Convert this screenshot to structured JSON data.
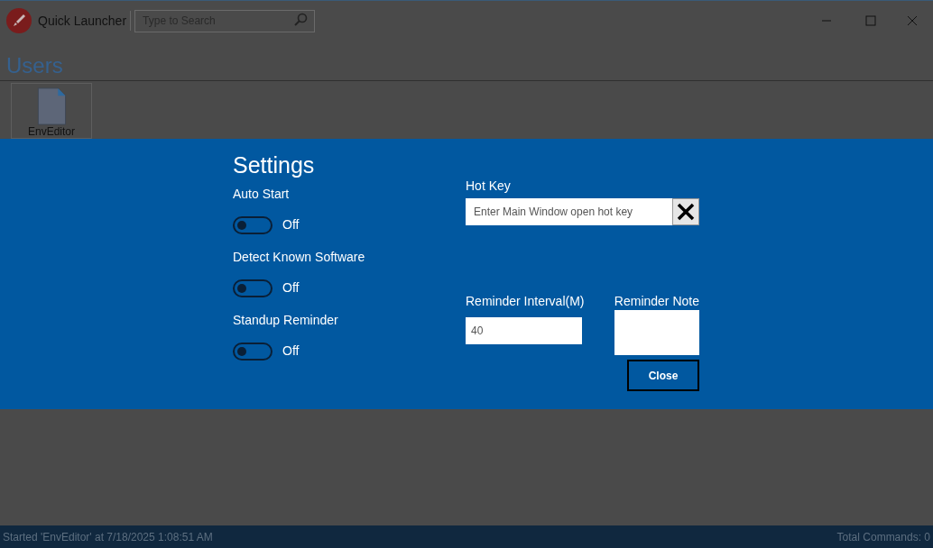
{
  "window": {
    "title": "Quick Launcher"
  },
  "search": {
    "placeholder": "Type to Search"
  },
  "group": {
    "title": "Users"
  },
  "tiles": [
    {
      "label": "EnvEditor"
    }
  ],
  "settings": {
    "title": "Settings",
    "toggles": [
      {
        "label": "Auto Start",
        "on": false,
        "state_text": "Off"
      },
      {
        "label": "Detect Known Software",
        "on": false,
        "state_text": "Off"
      },
      {
        "label": "Standup Reminder",
        "on": false,
        "state_text": "Off"
      }
    ],
    "hot_key": {
      "label": "Hot Key",
      "placeholder": "Enter Main Window open hot key"
    },
    "reminder_interval": {
      "label": "Reminder Interval(M)",
      "value": "40"
    },
    "reminder_note": {
      "label": "Reminder Note"
    },
    "close_button": "Close"
  },
  "status_bar": {
    "left": "Started 'EnvEditor' at 7/18/2025 1:08:51 AM",
    "right": "Total Commands: 0"
  }
}
